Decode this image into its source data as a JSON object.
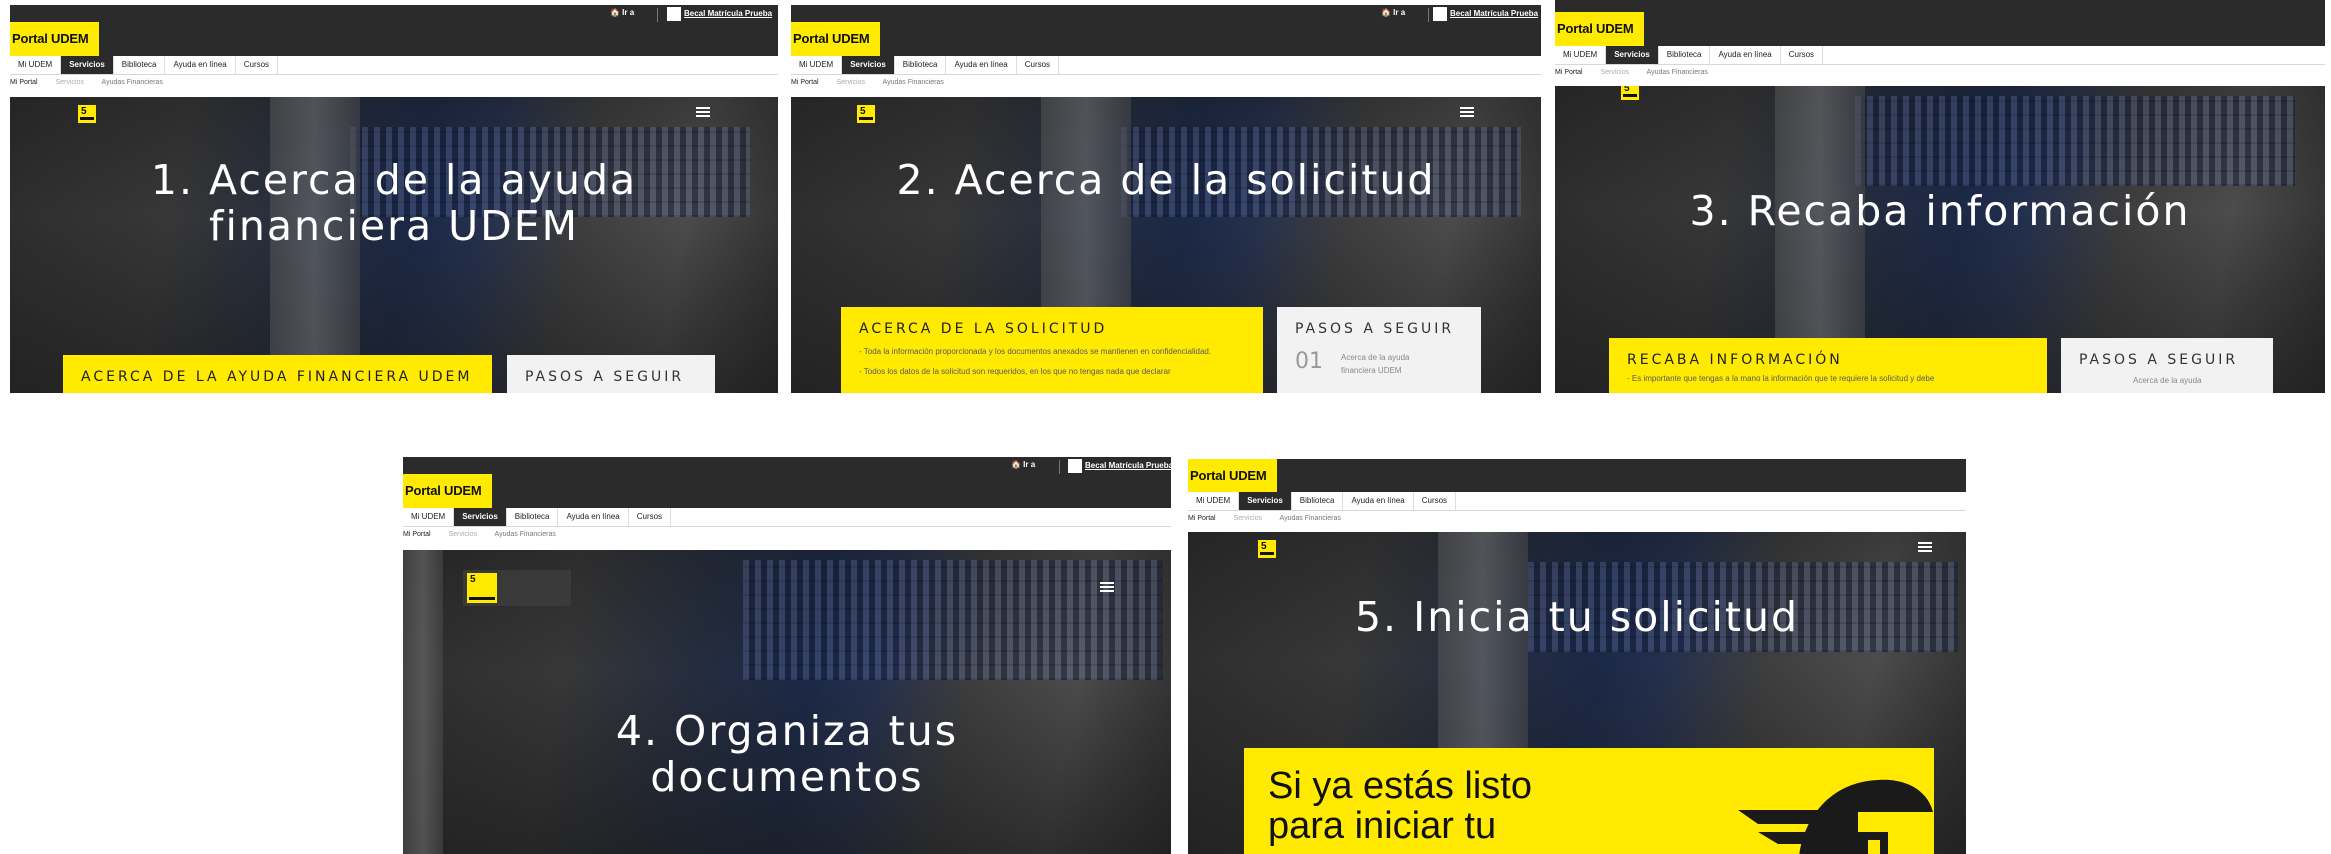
{
  "shared": {
    "topbar_ir": "🏠 Ir a",
    "topbar_user": "Becal Matrícula Prueba",
    "portal_label": "Portal UDEM",
    "nav": [
      "Mi UDEM",
      "Servicios",
      "Biblioteca",
      "Ayuda en línea",
      "Cursos"
    ],
    "nav_active_index": 1,
    "breadcrumbs": [
      "Mi Portal",
      "Servicios",
      "Ayudas Financieras"
    ],
    "steps_card_title": "PASOS A SEGUIR",
    "accent_color": "#ffea00",
    "dark_color": "#2b2b2b"
  },
  "panels": [
    {
      "hero_title_line1": "1. Acerca de la ayuda",
      "hero_title_line2": "financiera UDEM",
      "yellow_card_title": "ACERCA DE LA AYUDA FINANCIERA UDEM"
    },
    {
      "hero_title_line1": "2. Acerca de la solicitud",
      "yellow_card_title": "ACERCA DE LA SOLICITUD",
      "yellow_card_p1": "- Toda la información proporcionada y los documentos anexados se mantienen en confidencialidad.",
      "yellow_card_p2": "- Todos los datos de la solicitud son requeridos, en los que no tengas nada que declarar",
      "step_number": "01",
      "step_text": "Acerca de la ayuda financiera UDEM"
    },
    {
      "hero_title_line1": "3. Recaba información",
      "yellow_card_title": "RECABA INFORMACIÓN",
      "yellow_card_p1": "- Es importante que tengas a la mano la información que te requiere la solicitud y debe",
      "step_text": "Acerca de la ayuda"
    },
    {
      "hero_title_line1": "4. Organiza tus",
      "hero_title_line2": "documentos"
    },
    {
      "hero_title_line1": "5. Inicia tu solicitud",
      "big_card_line1": "Si ya estás listo",
      "big_card_line2": "para iniciar tu"
    }
  ]
}
